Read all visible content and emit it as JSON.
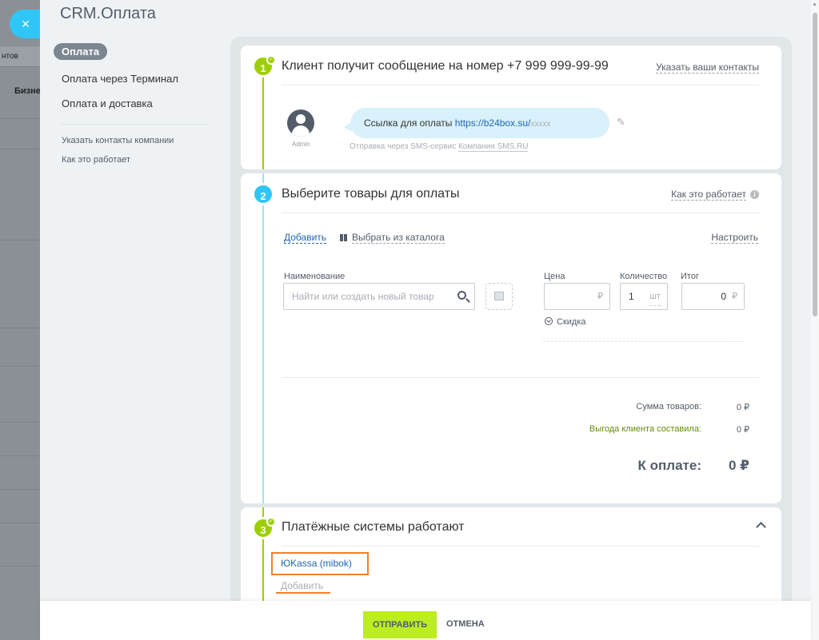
{
  "background": {
    "close_symbol": "×",
    "tab_label": "нтов",
    "row_label": "Бизне"
  },
  "slider": {
    "title": "CRM.Оплата"
  },
  "menu": {
    "active": "Оплата",
    "items": [
      "Оплата через Терминал",
      "Оплата и доставка"
    ],
    "small_links": [
      "Указать контакты компании",
      "Как это работает"
    ]
  },
  "step1": {
    "number": "1",
    "title": "Клиент получит сообщение на номер +7 999 999-99-99",
    "contacts_link": "Указать ваши контакты",
    "avatar_name": "Admin",
    "message_prefix": "Ссылка для оплаты ",
    "message_link": "https://b24box.su/",
    "message_tail": "xxxxx",
    "sms_note_prefix": "Отправка через SMS-сервис ",
    "sms_provider": "Компания SMS.RU"
  },
  "step2": {
    "number": "2",
    "title": "Выберите товары для оплаты",
    "how_link": "Как это работает",
    "add_link": "Добавить",
    "catalog_link": "Выбрать из каталога",
    "settings_link": "Настроить",
    "labels": {
      "name": "Наименование",
      "price": "Цена",
      "quantity": "Количество",
      "total": "Итог"
    },
    "search_placeholder": "Найти или создать новый товар",
    "price_currency": "₽",
    "quantity_value": "1",
    "quantity_unit": "шт",
    "total_value": "0",
    "total_currency": "₽",
    "discount_label": "Скидка",
    "sum_label": "Сумма товаров:",
    "sum_value": "0 ₽",
    "benefit_label": "Выгода клиента составила:",
    "benefit_value": "0 ₽",
    "pay_label": "К оплате:",
    "pay_value": "0 ₽"
  },
  "step3": {
    "number": "3",
    "title": "Платёжные системы работают",
    "paysystem": "ЮKassa (mibok)",
    "add_link": "Добавить"
  },
  "footer": {
    "send": "Отправить",
    "cancel": "Отмена"
  },
  "colors": {
    "green": "#9dcf00",
    "blue": "#2fc6f6",
    "accent_button": "#bbed21",
    "highlight": "#f37f28"
  }
}
